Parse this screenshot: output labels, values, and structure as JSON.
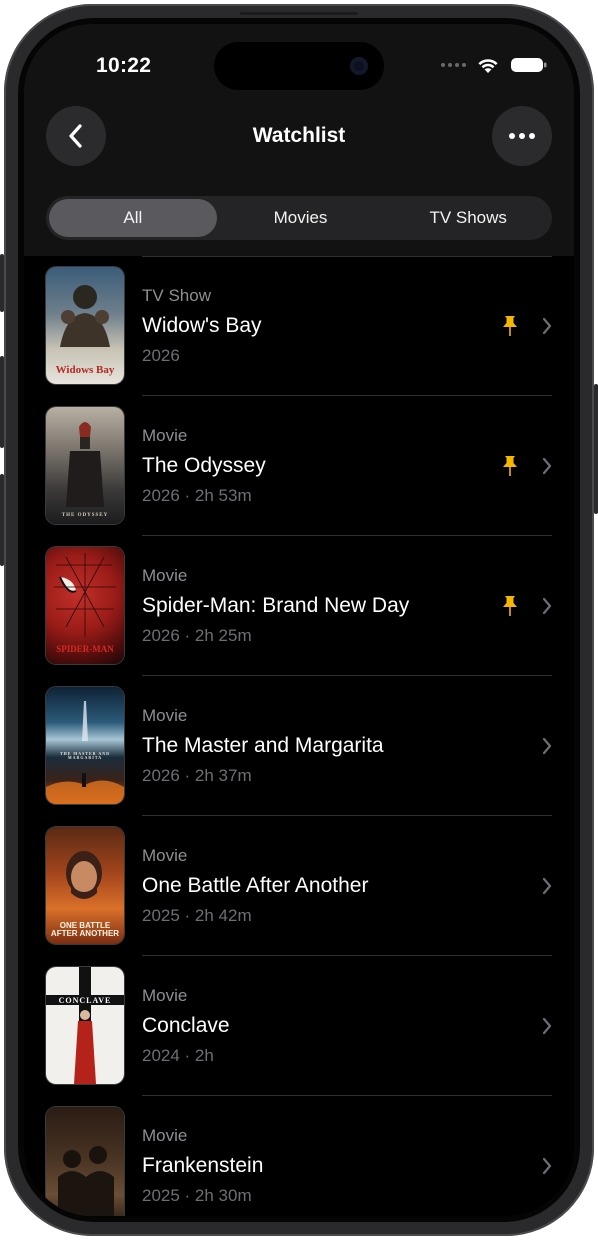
{
  "status_bar": {
    "time": "10:22"
  },
  "nav": {
    "title": "Watchlist"
  },
  "segments": [
    {
      "label": "All",
      "active": true
    },
    {
      "label": "Movies",
      "active": false
    },
    {
      "label": "TV Shows",
      "active": false
    }
  ],
  "items": [
    {
      "type": "TV Show",
      "title": "Widow's Bay",
      "meta": "2026",
      "pinned": true,
      "poster_wordmark": "Widows Bay"
    },
    {
      "type": "Movie",
      "title": "The Odyssey",
      "meta": "2026 · 2h 53m",
      "pinned": true,
      "poster_wordmark": "THE ODYSSEY"
    },
    {
      "type": "Movie",
      "title": "Spider-Man: Brand New Day",
      "meta": "2026 · 2h 25m",
      "pinned": true,
      "poster_wordmark": "SPIDER-MAN"
    },
    {
      "type": "Movie",
      "title": "The Master and Margarita",
      "meta": "2026 · 2h 37m",
      "pinned": false,
      "poster_wordmark": "THE MASTER AND MARGARITA"
    },
    {
      "type": "Movie",
      "title": "One Battle After Another",
      "meta": "2025 · 2h 42m",
      "pinned": false,
      "poster_wordmark": "ONE BATTLE AFTER ANOTHER"
    },
    {
      "type": "Movie",
      "title": "Conclave",
      "meta": "2024 · 2h",
      "pinned": false,
      "poster_wordmark": "CONCLAVE"
    },
    {
      "type": "Movie",
      "title": "Frankenstein",
      "meta": "2025 · 2h 30m",
      "pinned": false,
      "poster_wordmark": ""
    }
  ],
  "colors": {
    "background": "#000000",
    "header": "#121212",
    "segment_active": "#5a5a5e",
    "pin": "#f5b700",
    "secondary_text": "#8e8e93"
  },
  "icons": {
    "back": "chevron-left-icon",
    "more": "ellipsis-icon",
    "pin": "pushpin-icon",
    "row_chevron": "chevron-right-icon",
    "wifi": "wifi-icon",
    "battery": "battery-icon"
  }
}
